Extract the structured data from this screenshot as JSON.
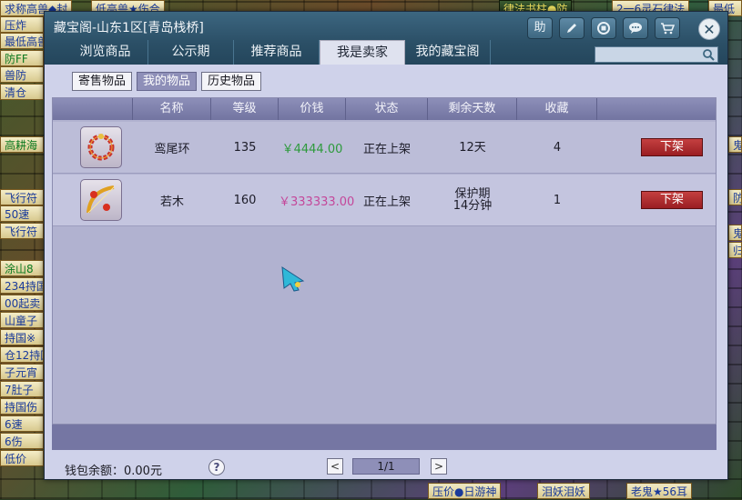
{
  "background_text": {
    "chips": [
      "求称高兽◆封",
      "低高兽★伤合",
      "压炸",
      "最低高兽",
      "防FF",
      "兽防",
      "清仓",
      "高耕海",
      "飞行符",
      "飞行符",
      "50速",
      "涂山8",
      "234持国",
      "00起卖",
      "山童子",
      "持国※",
      "仓12持国",
      "子元宵",
      "7肚子",
      "持国伤",
      "6速",
      "6伤",
      "低价",
      "律法书柱●防",
      "2一6灵石律法",
      "最低",
      "鬼",
      "防",
      "鬼",
      "归",
      "压价●日游神",
      "泪妖泪妖",
      "老鬼★56耳"
    ]
  },
  "window": {
    "title": "藏宝阁-山东1区[青岛栈桥]",
    "tool_buttons": [
      "助",
      "✎",
      "■",
      "💬",
      "🛒"
    ],
    "close_label": "✕",
    "tabs": [
      {
        "label": "浏览商品"
      },
      {
        "label": "公示期"
      },
      {
        "label": "推荐商品"
      },
      {
        "label": "我是卖家"
      },
      {
        "label": "我的藏宝阁"
      }
    ],
    "active_tab": "我是卖家",
    "search": {
      "value": "",
      "placeholder": ""
    }
  },
  "subtabs": [
    {
      "label": "寄售物品"
    },
    {
      "label": "我的物品"
    },
    {
      "label": "历史物品"
    }
  ],
  "table": {
    "headers": [
      "名称",
      "等级",
      "价钱",
      "状态",
      "剩余天数",
      "收藏"
    ],
    "rows": [
      {
        "icon": "red-bead-bracelet-icon",
        "name": "鸾尾环",
        "level": "135",
        "price": "￥4444.00",
        "status": "正在上架",
        "days_line1": "12天",
        "days_line2": "",
        "favorites": "4",
        "action": "下架"
      },
      {
        "icon": "golden-bow-icon",
        "name": "若木",
        "level": "160",
        "price": "￥333333.00",
        "status": "正在上架",
        "days_line1": "保护期",
        "days_line2": "14分钟",
        "favorites": "1",
        "action": "下架"
      }
    ]
  },
  "footer": {
    "wallet_label": "钱包余额：0.00元",
    "help": "?",
    "prev": "<",
    "next": ">",
    "page": "1/1"
  },
  "colors": {
    "header": "#2b4f66",
    "price_green": "#2d9a3c",
    "price_pink": "#c4479a",
    "unlist_button": "#b02a2e"
  }
}
